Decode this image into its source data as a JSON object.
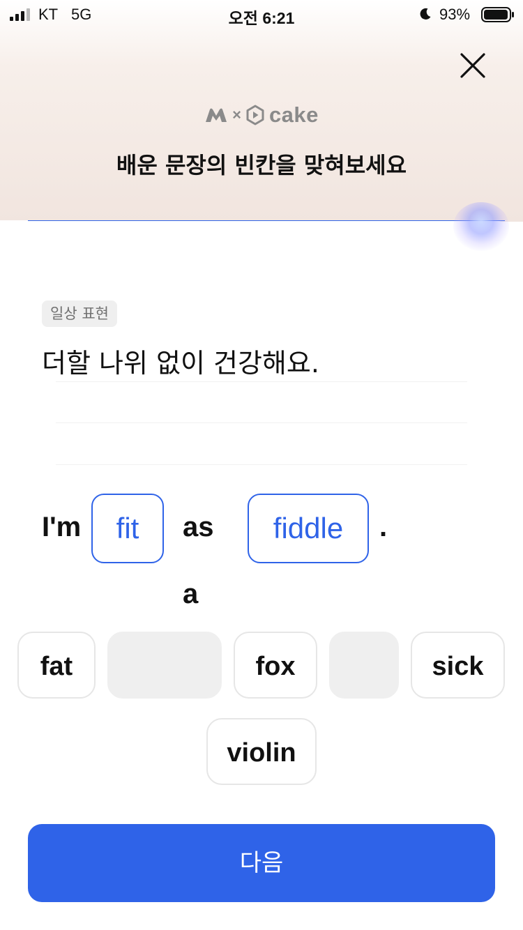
{
  "status_bar": {
    "carrier": "KT",
    "network": "5G",
    "time": "오전 6:21",
    "battery": "93%",
    "icons": [
      "signal-icon",
      "moon-icon",
      "battery-icon"
    ]
  },
  "header": {
    "close_icon": "close-icon",
    "brand_separator": "×",
    "brand_name": "cake",
    "title": "배운 문장의 빈칸을 맞혀보세요"
  },
  "quiz": {
    "category": "일상 표현",
    "sentence_ko": "더할 나위 없이 건강해요.",
    "sentence_en": {
      "part1": "I'm",
      "blank1": "fit",
      "part2": "as a",
      "blank2": "fiddle",
      "end": "."
    },
    "options": [
      {
        "label": "fat",
        "used": false
      },
      {
        "label": "",
        "used": true
      },
      {
        "label": "fox",
        "used": false
      },
      {
        "label": "",
        "used": true
      },
      {
        "label": "sick",
        "used": false
      },
      {
        "label": "violin",
        "used": false
      }
    ],
    "progress": 1.0
  },
  "footer": {
    "next_label": "다음"
  },
  "colors": {
    "accent": "#2f63e8",
    "chip_bg": "#efefef",
    "header_gradient_end": "#f1e5df"
  }
}
